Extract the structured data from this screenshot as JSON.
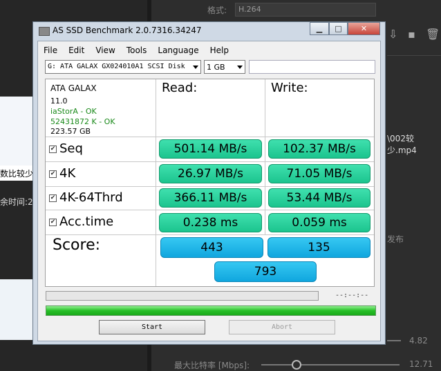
{
  "background": {
    "format_label": "格式:",
    "format_value": "H.264",
    "file_snip": "\\002较少.mp4",
    "left_text_1": "数比较少",
    "left_text_2": "余时间:2",
    "right_text_1": "发布",
    "value_1": "4.82",
    "bitrate_label": "最大比特率 [Mbps]:",
    "value_2": "12.71"
  },
  "window": {
    "title": "AS SSD Benchmark 2.0.7316.34247",
    "min_glyph": "▁",
    "max_glyph": "□",
    "close_glyph": "✕"
  },
  "menu": [
    "File",
    "Edit",
    "View",
    "Tools",
    "Language",
    "Help"
  ],
  "drive_select": {
    "value": "G: ATA GALAX GX024010A1 SCSI Disk"
  },
  "size_select": {
    "value": "1 GB"
  },
  "drive_info": {
    "name": "ATA GALAX",
    "firmware": "11.0",
    "driver": "iaStorA - OK",
    "alignment": "52431872 K - OK",
    "capacity": "223.57 GB"
  },
  "headers": {
    "read": "Read:",
    "write": "Write:"
  },
  "tests": [
    {
      "label": "Seq",
      "checked": true,
      "read": "501.14 MB/s",
      "write": "102.37 MB/s"
    },
    {
      "label": "4K",
      "checked": true,
      "read": "26.97 MB/s",
      "write": "71.05 MB/s"
    },
    {
      "label": "4K-64Thrd",
      "checked": true,
      "read": "366.11 MB/s",
      "write": "53.44 MB/s"
    },
    {
      "label": "Acc.time",
      "checked": true,
      "read": "0.238 ms",
      "write": "0.059 ms"
    }
  ],
  "score": {
    "label": "Score:",
    "read": "443",
    "write": "135",
    "total": "793"
  },
  "progress": {
    "time": "--:--:--",
    "fraction": 0
  },
  "buttons": {
    "start": "Start",
    "abort": "Abort"
  },
  "colors": {
    "result_green": "#2ad49c",
    "score_blue": "#1cb2e8",
    "progress_green": "#27c027"
  }
}
